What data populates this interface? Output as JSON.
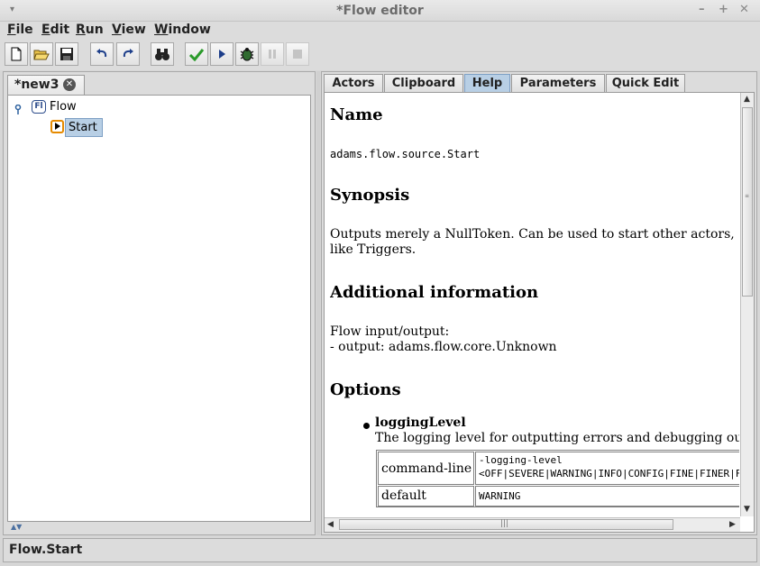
{
  "window": {
    "title": "*Flow editor",
    "menu_glyph": "▾",
    "minimize_glyph": "–",
    "maximize_glyph": "+",
    "close_glyph": "✕"
  },
  "menubar": {
    "items": [
      {
        "mnemonic": "F",
        "rest": "ile"
      },
      {
        "mnemonic": "E",
        "rest": "dit"
      },
      {
        "mnemonic": "R",
        "rest": "un"
      },
      {
        "mnemonic": "V",
        "rest": "iew"
      },
      {
        "mnemonic": "W",
        "rest": "indow"
      }
    ]
  },
  "toolbar": {
    "icons": [
      "new-icon",
      "open-folder-icon",
      "save-icon",
      "undo-icon",
      "redo-icon",
      "binoculars-icon",
      "check-icon",
      "run-icon",
      "debug-bug-icon",
      "pause-icon",
      "stop-icon"
    ]
  },
  "left": {
    "tab_label": "*new3",
    "tab_close": "✕",
    "tree": {
      "root_badge": "Fl",
      "root_label": "Flow",
      "child_label": "Start"
    },
    "splitter_arrows": "▲▼"
  },
  "right": {
    "tabs": [
      {
        "label": "Actors"
      },
      {
        "label": "Clipboard"
      },
      {
        "label": "Help"
      },
      {
        "label": "Parameters"
      },
      {
        "label": "Quick Edit"
      }
    ],
    "active_tab": "Help",
    "help": {
      "name_heading": "Name",
      "name_value": "adams.flow.source.Start",
      "synopsis_heading": "Synopsis",
      "synopsis_line1": "Outputs merely a NullToken. Can be used to start other actors,",
      "synopsis_line2": "like Triggers.",
      "additional_heading": "Additional information",
      "additional_line1": "Flow input/output:",
      "additional_line2": "- output: adams.flow.core.Unknown",
      "options_heading": "Options",
      "option_name": "loggingLevel",
      "option_desc": "The logging level for outputting errors and debugging output.",
      "table": {
        "row1_label": "command-line",
        "row1_value_line1": "-logging-level",
        "row1_value_line2": "<OFF|SEVERE|WARNING|INFO|CONFIG|FINE|FINER|FINEST>",
        "row2_label": "default",
        "row2_value": "WARNING"
      }
    },
    "scroll": {
      "up": "▲",
      "down": "▼",
      "left": "◀",
      "right": "▶",
      "grip": "|||"
    }
  },
  "statusbar": {
    "text": "Flow.Start"
  }
}
